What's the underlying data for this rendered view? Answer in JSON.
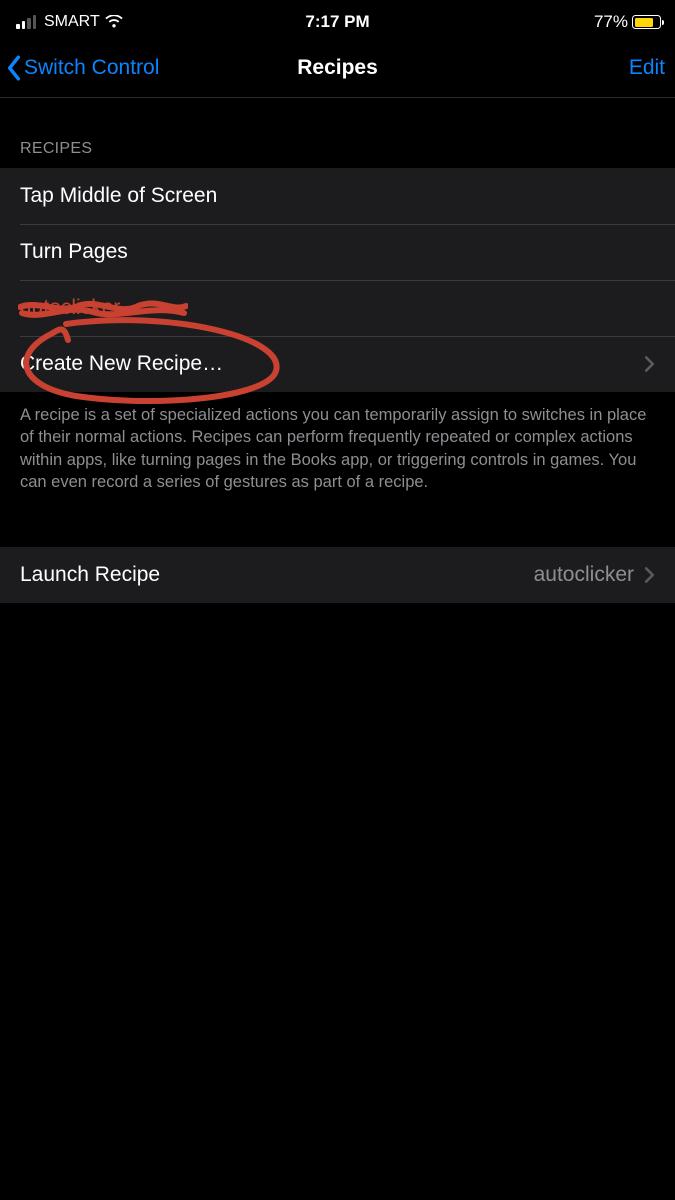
{
  "status": {
    "carrier": "SMART",
    "time": "7:17 PM",
    "battery_pct": "77%"
  },
  "nav": {
    "back_label": "Switch Control",
    "title": "Recipes",
    "edit_label": "Edit"
  },
  "section": {
    "header": "RECIPES",
    "rows": [
      {
        "label": "Tap Middle of Screen"
      },
      {
        "label": "Turn Pages"
      },
      {
        "label": "autoclicker"
      },
      {
        "label": "Create New Recipe…"
      }
    ],
    "footer": "A recipe is a set of specialized actions you can temporarily assign to switches in place of their normal actions. Recipes can perform frequently repeated or complex actions within apps, like turning pages in the Books app, or triggering controls in games. You can even record a series of gestures as part of a recipe."
  },
  "launch": {
    "label": "Launch Recipe",
    "value": "autoclicker"
  },
  "annotation": {
    "color": "#c84131"
  }
}
